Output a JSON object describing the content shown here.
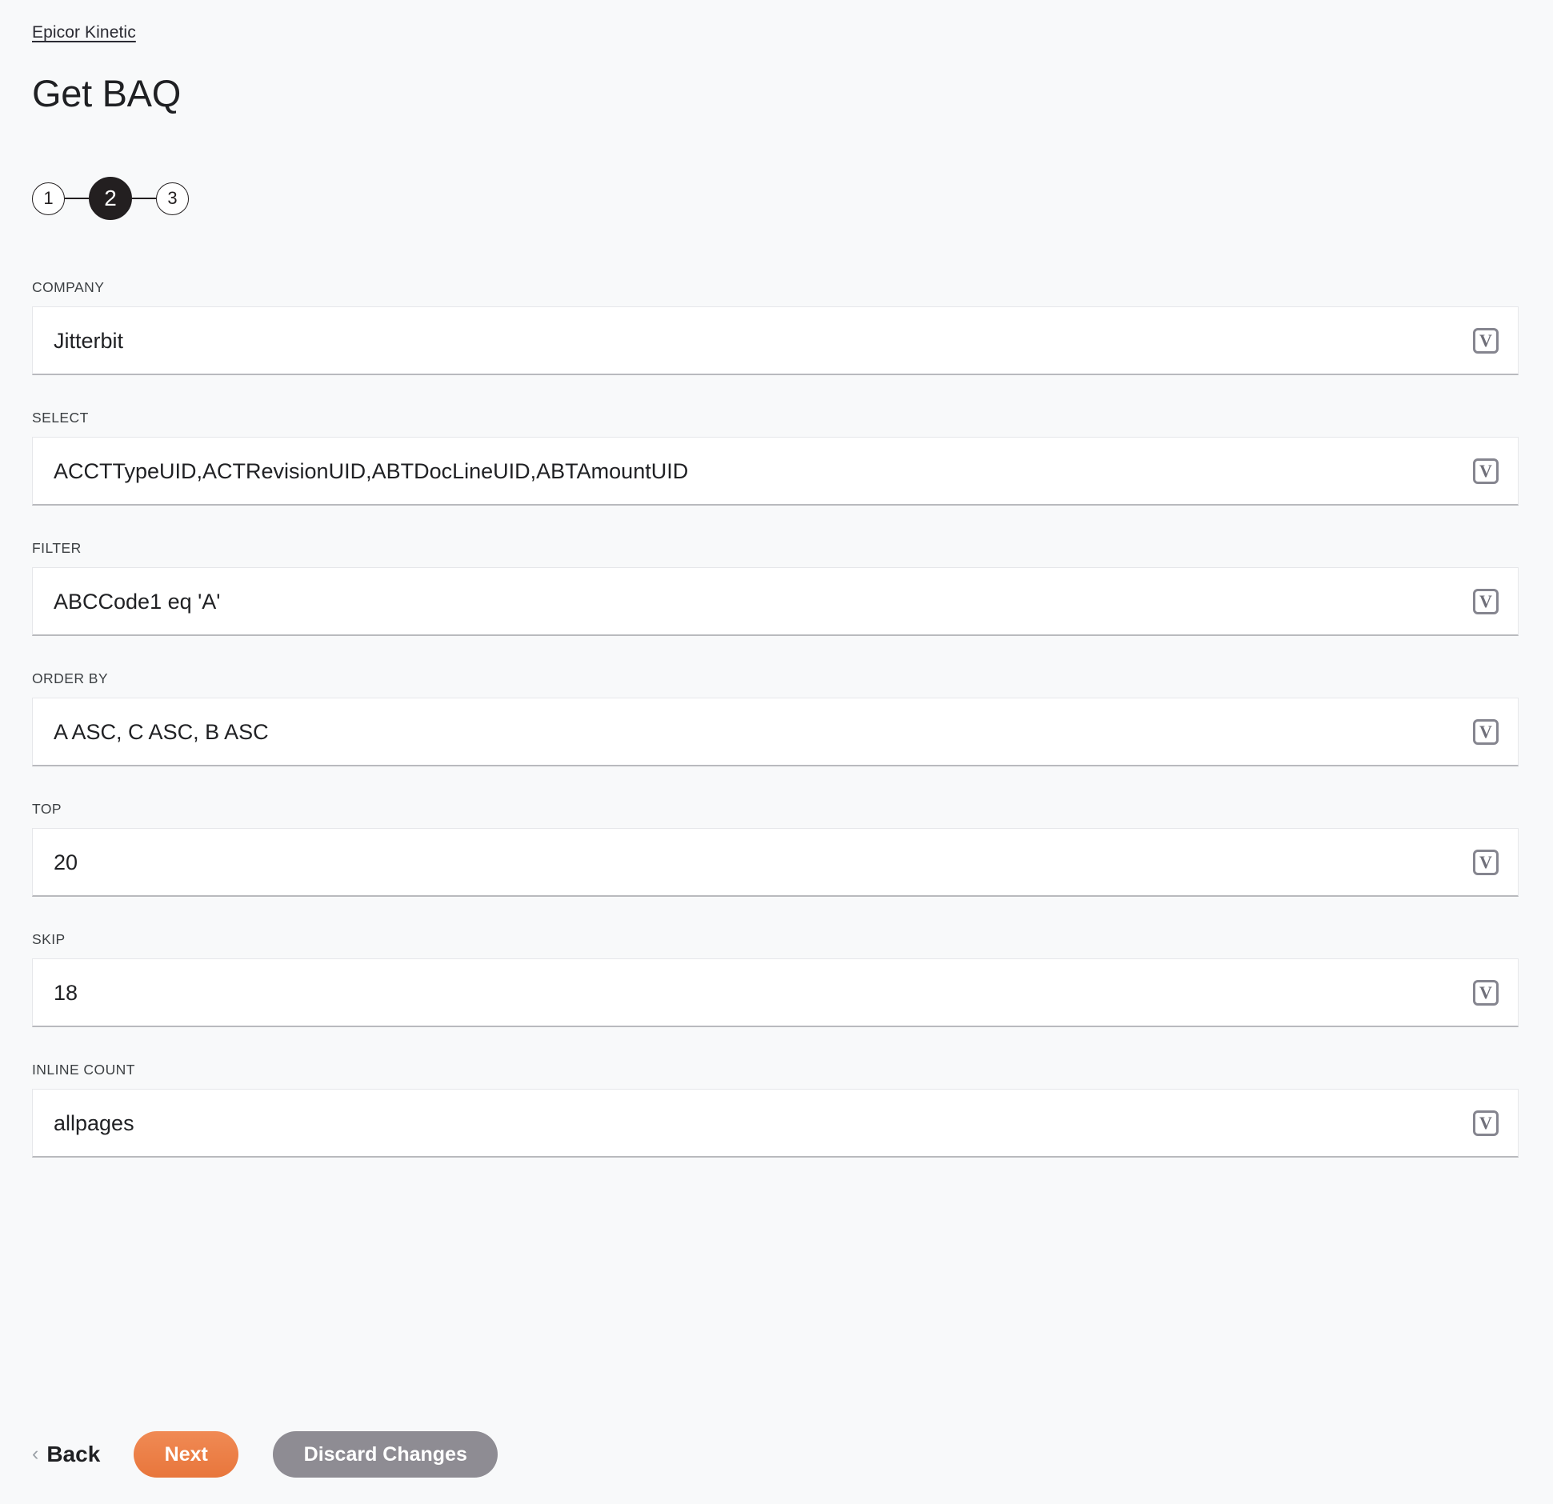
{
  "breadcrumb": {
    "label": "Epicor Kinetic"
  },
  "header": {
    "title": "Get BAQ"
  },
  "stepper": {
    "steps": [
      {
        "label": "1",
        "active": false
      },
      {
        "label": "2",
        "active": true
      },
      {
        "label": "3",
        "active": false
      }
    ]
  },
  "icons": {
    "variable": "V",
    "variable_name": "variable-icon",
    "back_chevron": "‹"
  },
  "form": {
    "fields": [
      {
        "label": "COMPANY",
        "value": "Jitterbit",
        "placeholder": ""
      },
      {
        "label": "SELECT",
        "value": "ACCTTypeUID,ACTRevisionUID,ABTDocLineUID,ABTAmountUID",
        "placeholder": ""
      },
      {
        "label": "FILTER",
        "value": "ABCCode1 eq 'A'",
        "placeholder": ""
      },
      {
        "label": "ORDER BY",
        "value": "A ASC, C ASC, B ASC",
        "placeholder": ""
      },
      {
        "label": "TOP",
        "value": "20",
        "placeholder": ""
      },
      {
        "label": "SKIP",
        "value": "18",
        "placeholder": ""
      },
      {
        "label": "INLINE COUNT",
        "value": "allpages",
        "placeholder": ""
      }
    ]
  },
  "footer": {
    "back_label": "Back",
    "next_label": "Next",
    "discard_label": "Discard Changes"
  },
  "colors": {
    "page_background": "#f8f9fa",
    "accent_orange": "#e8763c",
    "discard_gray": "#8e8c93",
    "step_active": "#231f20",
    "input_border": "#e6e7ea",
    "input_border_bottom": "#b9babe",
    "text_primary": "#202124",
    "label_text": "#3c4043"
  }
}
